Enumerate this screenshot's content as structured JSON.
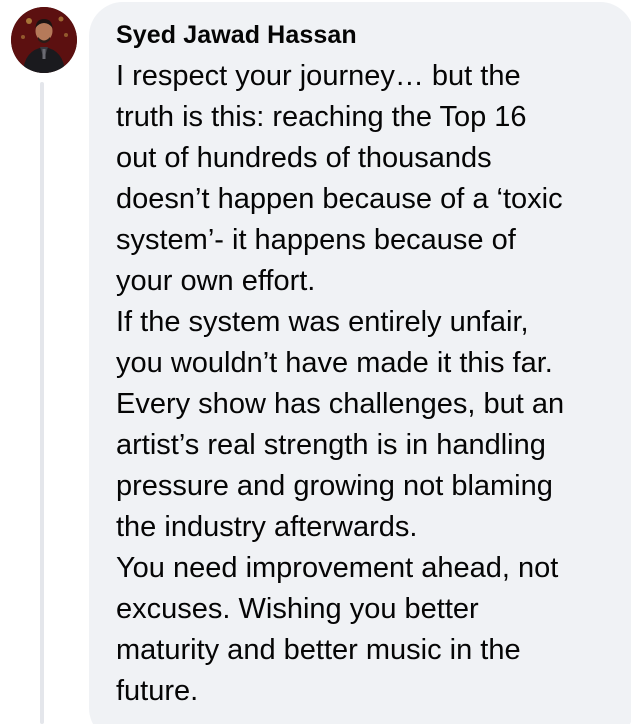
{
  "comment": {
    "author": "Syed Jawad Hassan",
    "avatar_icon": "user-avatar-photo",
    "text_lines": [
      "I respect your journey… but the",
      "truth is this: reaching the Top 16",
      "out of hundreds of thousands",
      "doesn’t happen because of a ‘toxic",
      "system’- it happens because of",
      "your own effort.",
      "If the system was entirely unfair,",
      "you wouldn’t have made it this far.",
      "Every show has challenges, but an",
      "artist’s real strength is in handling",
      "pressure and growing not blaming",
      "the industry afterwards.",
      "You need improvement ahead, not",
      "excuses. Wishing you better",
      "maturity and better music in the",
      "future."
    ]
  },
  "colors": {
    "bubble_background": "#f0f2f5",
    "text": "#050505",
    "thread_line": "#e4e6eb"
  }
}
